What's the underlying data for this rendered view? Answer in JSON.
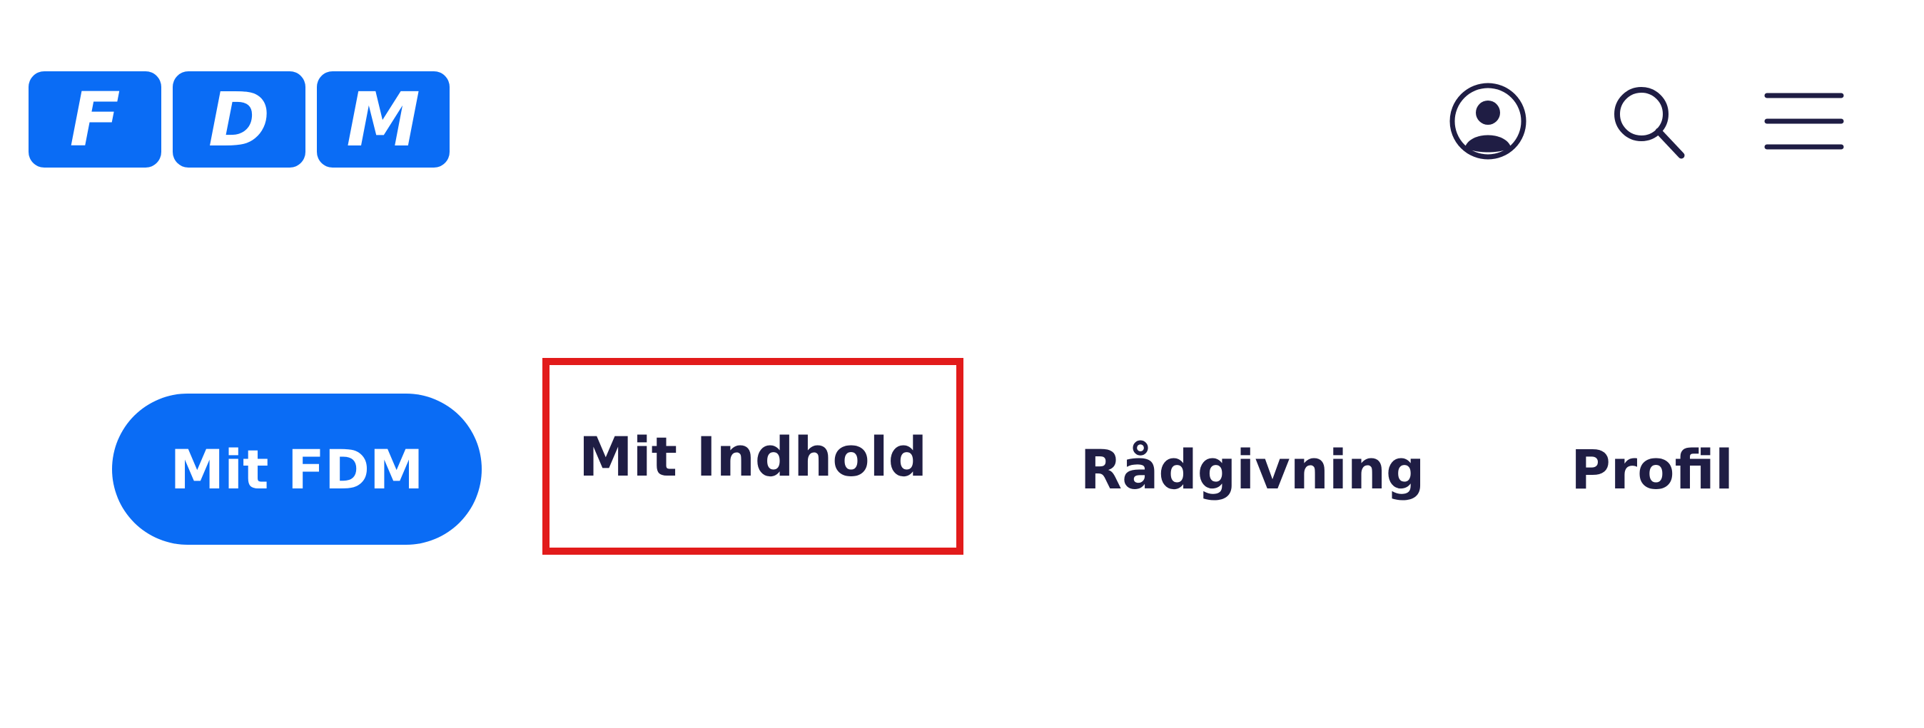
{
  "header": {
    "logo_letters": [
      "F",
      "D",
      "M"
    ],
    "logo_color": "#0a6cf5",
    "icons": {
      "account": "account-icon",
      "search": "search-icon",
      "menu": "hamburger-menu-icon"
    },
    "icon_color": "#1f1d44"
  },
  "tabs": [
    {
      "label": "Mit FDM",
      "active": true
    },
    {
      "label": "Mit Indhold",
      "active": false,
      "highlighted": true
    },
    {
      "label": "Rådgivning",
      "active": false
    },
    {
      "label": "Profil",
      "active": false
    }
  ],
  "colors": {
    "accent": "#0a6cf5",
    "text": "#1f1d44",
    "highlight_border": "#e21b1b"
  }
}
